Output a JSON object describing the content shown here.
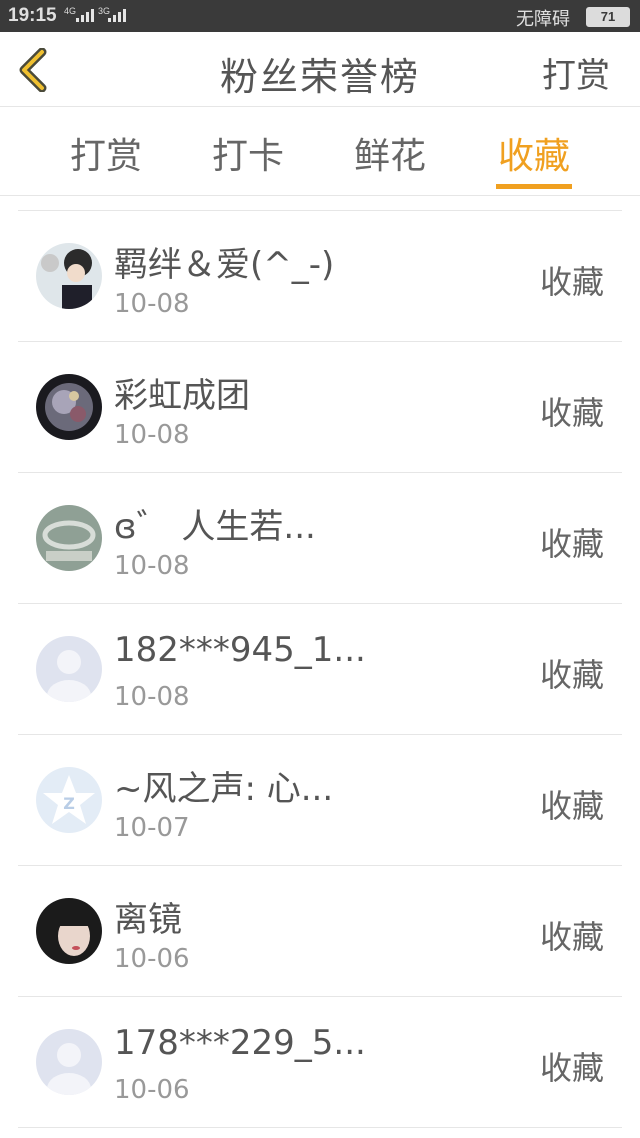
{
  "status_bar": {
    "time": "19:15",
    "network1": "4G",
    "network2": "3G",
    "accessibility": "无障碍",
    "battery": "71"
  },
  "header": {
    "back_icon": "chevron-left-icon",
    "title": "粉丝荣誉榜",
    "action": "打赏",
    "accent": "#f0a020"
  },
  "tabs": [
    {
      "label": "打赏",
      "active": false
    },
    {
      "label": "打卡",
      "active": false
    },
    {
      "label": "鲜花",
      "active": false
    },
    {
      "label": "收藏",
      "active": true
    }
  ],
  "fans": [
    {
      "name": "羁绊＆爱(^_-)",
      "date": "10-08",
      "action": "收藏",
      "avatar": "photo-avatar"
    },
    {
      "name": "彩虹成团",
      "date": "10-08",
      "action": "收藏",
      "avatar": "photo-avatar"
    },
    {
      "name": "ɞ゛ 人生若...",
      "date": "10-08",
      "action": "收藏",
      "avatar": "photo-avatar"
    },
    {
      "name": "182***945_1...",
      "date": "10-08",
      "action": "收藏",
      "avatar": "default-user-avatar"
    },
    {
      "name": "~风之声: 心...",
      "date": "10-07",
      "action": "收藏",
      "avatar": "qq-star-avatar"
    },
    {
      "name": "离镜",
      "date": "10-06",
      "action": "收藏",
      "avatar": "photo-avatar"
    },
    {
      "name": "178***229_5...",
      "date": "10-06",
      "action": "收藏",
      "avatar": "default-user-avatar"
    }
  ]
}
